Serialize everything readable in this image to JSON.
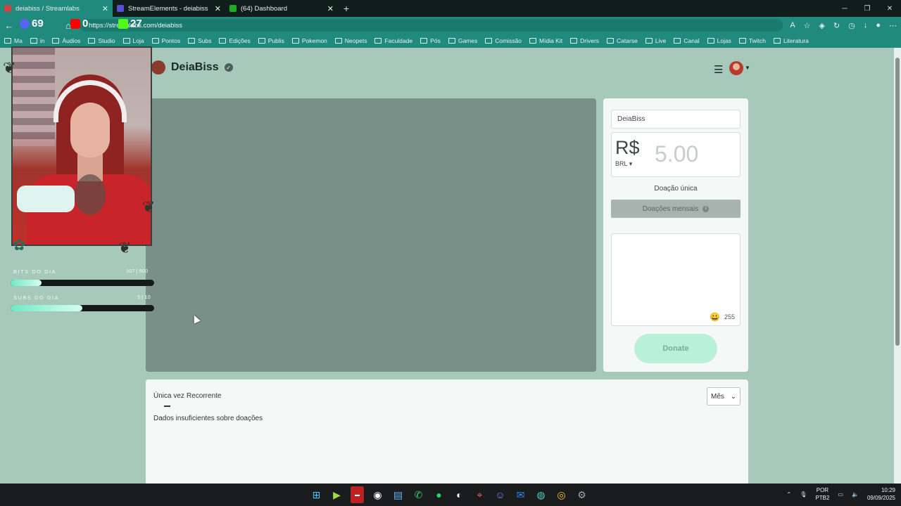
{
  "browser": {
    "tabs": [
      {
        "title": "deiabiss / Streamlabs",
        "color": "#c44",
        "active": true
      },
      {
        "title": "StreamElements - deiabiss",
        "color": "#5a4fd6",
        "active": false
      },
      {
        "title": "(64) Dashboard",
        "color": "#2a2",
        "active": false
      }
    ],
    "url": "https://streamlabs.com/deiabiss",
    "bookmarks": [
      "Ma",
      "in",
      "Áudios",
      "Studio",
      "Loja",
      "Pontos",
      "Subs",
      "Edições",
      "Publis",
      "Pokemon",
      "Neopets",
      "Faculdade",
      "Pós",
      "Games",
      "Comissão",
      "Mídia Kit",
      "Drivers",
      "Catarse",
      "Live",
      "Canal",
      "Lojas",
      "Twitch",
      "Literatura"
    ]
  },
  "page": {
    "streamer_name": "DeiaBiss"
  },
  "donation": {
    "name_value": "DeiaBiss",
    "currency_symbol": "R$",
    "currency_code": "BRL",
    "amount_placeholder": "5.00",
    "one_time_label": "Doação única",
    "monthly_label": "Doações mensais",
    "char_count": "255",
    "donate_label": "Donate"
  },
  "history": {
    "tab_once": "Única vez",
    "tab_recurring": "Recorrente",
    "period": "Mês",
    "empty_text": "Dados insuficientes sobre doações"
  },
  "overlay": {
    "counters": [
      {
        "value": "69",
        "color": "#5865f2"
      },
      {
        "value": "0",
        "color": "#ff0000"
      },
      {
        "value": "27",
        "color": "#53fc18"
      }
    ],
    "bits_label": "BITS DO DIA",
    "bits_value": "107 | 500",
    "bits_fraction": 0.214,
    "subs_label": "SUBS DO DIA",
    "subs_value": "5 | 10",
    "subs_fraction": 0.5
  },
  "taskbar": {
    "lang_top": "POR",
    "lang_bottom": "PTB2",
    "time": "10:29",
    "date": "09/09/2025"
  }
}
